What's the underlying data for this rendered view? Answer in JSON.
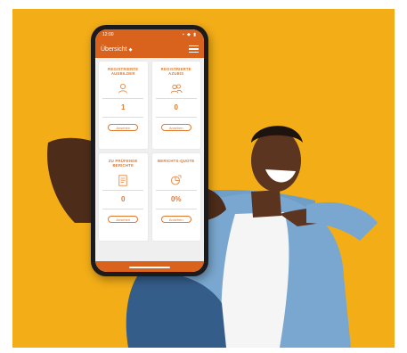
{
  "image": {
    "background_color": "#f3ad17",
    "subject": "person holding smartphone"
  },
  "app": {
    "status_time": "12:00",
    "status_icons": "▪ ◆ ▮",
    "title": "Übersicht",
    "title_indicator": "◆",
    "accent": "#d9621c"
  },
  "cards": [
    {
      "title": "REGISTRIERTE AUSBILDER",
      "icon": "user-icon",
      "value": "1",
      "button": "Ansehen"
    },
    {
      "title": "REGISTRIERTE AZUBIS",
      "icon": "users-icon",
      "value": "0",
      "button": "Ansehen"
    },
    {
      "title": "ZU PRÜFENDE BERICHTE",
      "icon": "document-icon",
      "value": "0",
      "button": "Ansehen"
    },
    {
      "title": "BERICHTS-QUOTE",
      "icon": "chart-icon",
      "value": "0%",
      "button": "Ansehen"
    }
  ]
}
